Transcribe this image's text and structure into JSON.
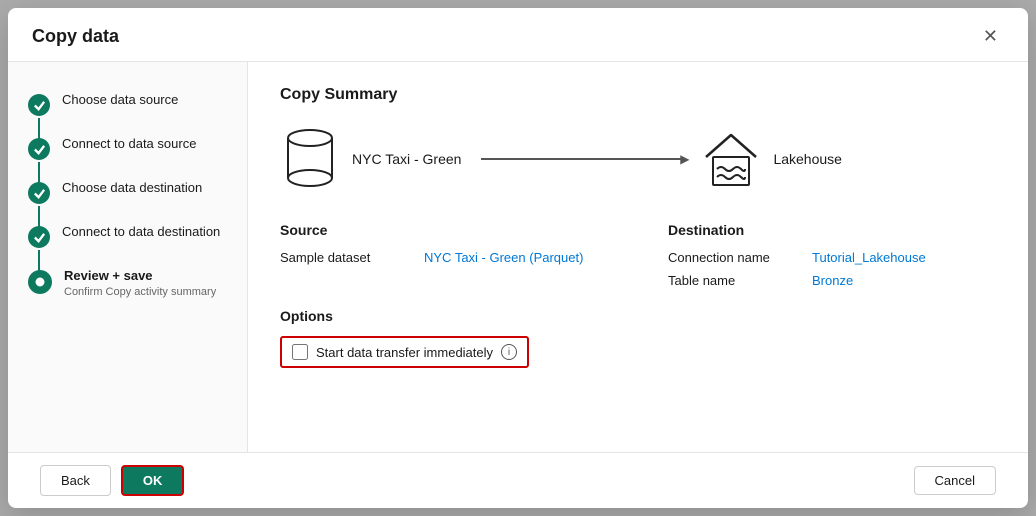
{
  "modal": {
    "title": "Copy data",
    "close_label": "✕"
  },
  "sidebar": {
    "steps": [
      {
        "id": "choose-source",
        "label": "Choose data source",
        "sublabel": "",
        "completed": true,
        "active": false
      },
      {
        "id": "connect-source",
        "label": "Connect to data source",
        "sublabel": "",
        "completed": true,
        "active": false
      },
      {
        "id": "choose-destination",
        "label": "Choose data destination",
        "sublabel": "",
        "completed": true,
        "active": false
      },
      {
        "id": "connect-destination",
        "label": "Connect to data destination",
        "sublabel": "",
        "completed": true,
        "active": false
      },
      {
        "id": "review-save",
        "label": "Review + save",
        "sublabel": "Confirm Copy activity summary",
        "completed": false,
        "active": true
      }
    ]
  },
  "main": {
    "section_title": "Copy Summary",
    "diagram": {
      "source_label": "NYC Taxi - Green",
      "dest_label": "Lakehouse"
    },
    "source": {
      "title": "Source",
      "rows": [
        {
          "key": "Sample dataset",
          "value": "NYC Taxi - Green (Parquet)"
        }
      ]
    },
    "destination": {
      "title": "Destination",
      "rows": [
        {
          "key": "Connection name",
          "value": "Tutorial_Lakehouse"
        },
        {
          "key": "Table name",
          "value": "Bronze"
        }
      ]
    },
    "options": {
      "title": "Options",
      "checkbox_label": "Start data transfer immediately",
      "info_tooltip": "ⓘ"
    }
  },
  "footer": {
    "back_label": "Back",
    "ok_label": "OK",
    "cancel_label": "Cancel"
  }
}
